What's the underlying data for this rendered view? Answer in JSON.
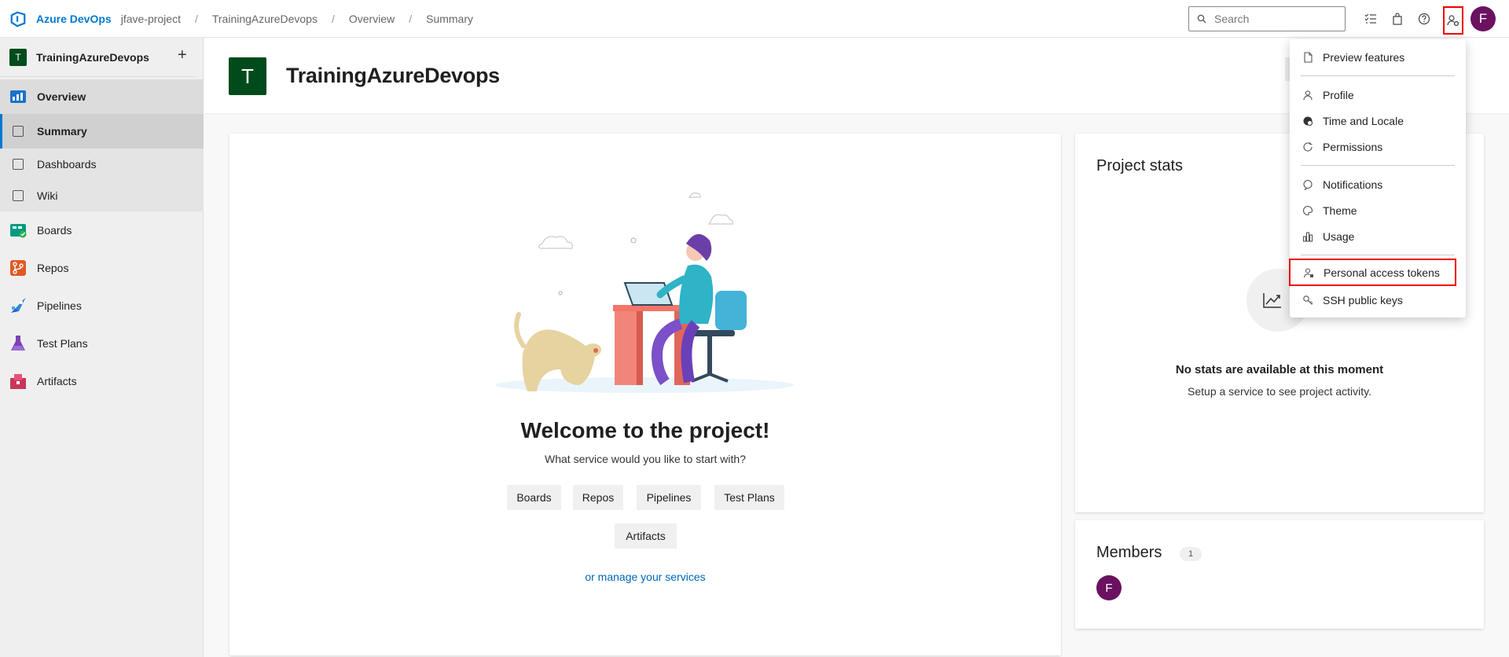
{
  "topbar": {
    "brand": "Azure DevOps",
    "breadcrumbs": [
      "jfave-project",
      "TrainingAzureDevops",
      "Overview",
      "Summary"
    ],
    "search_placeholder": "Search",
    "avatar_initial": "F"
  },
  "sidebar": {
    "project_initial": "T",
    "project_name": "TrainingAzureDevops",
    "add_symbol": "+",
    "items": [
      {
        "label": "Overview"
      },
      {
        "label": "Summary"
      },
      {
        "label": "Dashboards"
      },
      {
        "label": "Wiki"
      },
      {
        "label": "Boards"
      },
      {
        "label": "Repos"
      },
      {
        "label": "Pipelines"
      },
      {
        "label": "Test Plans"
      },
      {
        "label": "Artifacts"
      }
    ]
  },
  "header": {
    "project_initial": "T",
    "title": "TrainingAzureDevops"
  },
  "welcome": {
    "title": "Welcome to the project!",
    "subtitle": "What service would you like to start with?",
    "services": [
      "Boards",
      "Repos",
      "Pipelines",
      "Test Plans",
      "Artifacts"
    ],
    "manage_link": "or manage your services"
  },
  "stats": {
    "title": "Project stats",
    "empty_title": "No stats are available at this moment",
    "empty_subtitle": "Setup a service to see project activity."
  },
  "members": {
    "title": "Members",
    "count": "1",
    "avatar_initial": "F"
  },
  "user_menu": {
    "items": [
      {
        "label": "Preview features",
        "icon": "document-icon"
      },
      {
        "label": "Profile",
        "icon": "profile-icon"
      },
      {
        "label": "Time and Locale",
        "icon": "globe-icon"
      },
      {
        "label": "Permissions",
        "icon": "refresh-icon"
      },
      {
        "label": "Notifications",
        "icon": "chat-icon"
      },
      {
        "label": "Theme",
        "icon": "palette-icon"
      },
      {
        "label": "Usage",
        "icon": "chart-icon"
      },
      {
        "label": "Personal access tokens",
        "icon": "token-icon"
      },
      {
        "label": "SSH public keys",
        "icon": "key-icon"
      }
    ]
  },
  "colors": {
    "accent": "#0078d4",
    "project_badge": "#004b1c",
    "avatar": "#6b1160",
    "highlight": "#ee0000"
  }
}
